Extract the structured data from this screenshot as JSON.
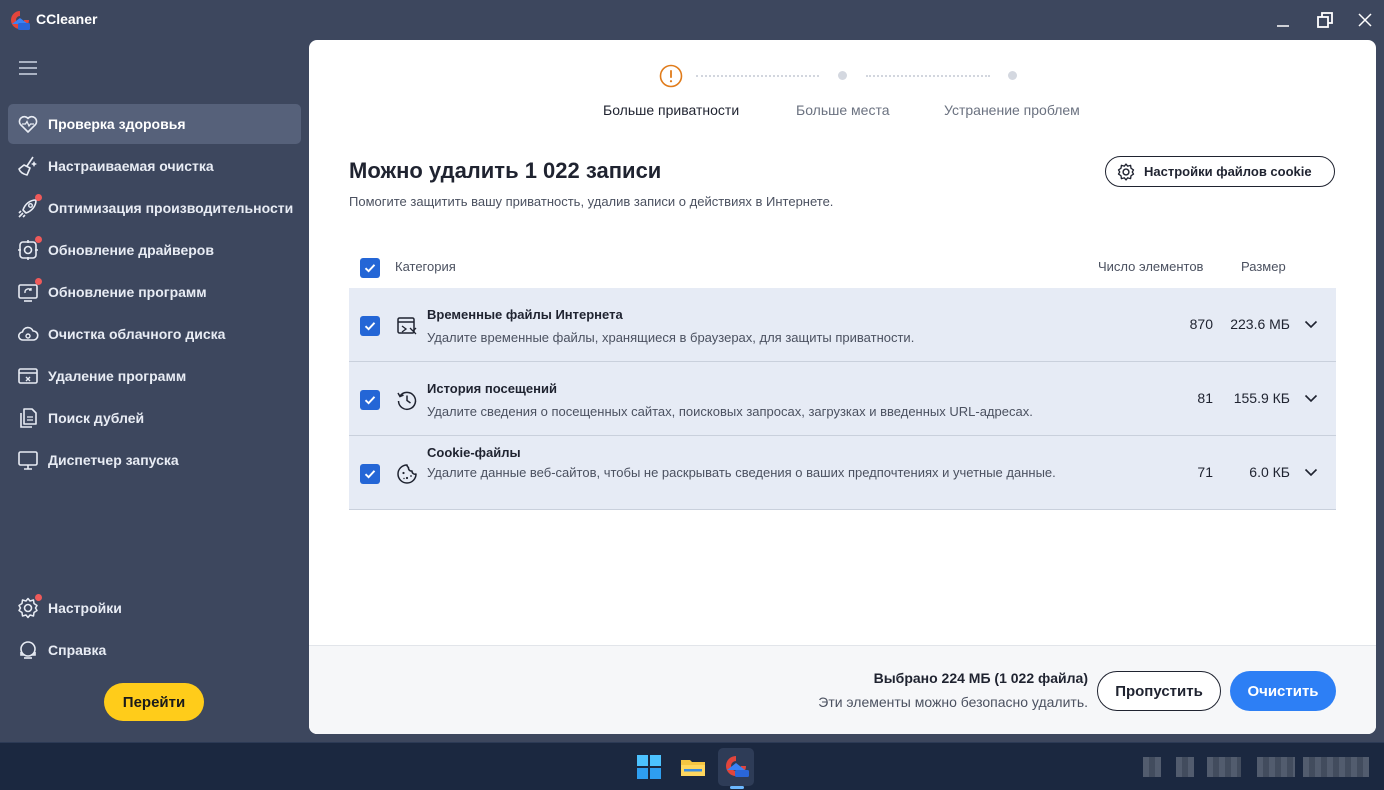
{
  "app": {
    "title": "CCleaner"
  },
  "sidebar": {
    "items": [
      {
        "label": "Проверка здоровья",
        "icon": "heart-icon",
        "active": true,
        "dot": false
      },
      {
        "label": "Настраиваемая очистка",
        "icon": "broom-icon",
        "active": false,
        "dot": false
      },
      {
        "label": "Оптимизация производительности",
        "icon": "rocket-icon",
        "active": false,
        "dot": true
      },
      {
        "label": "Обновление драйверов",
        "icon": "driver-gear-icon",
        "active": false,
        "dot": true
      },
      {
        "label": "Обновление программ",
        "icon": "software-update-icon",
        "active": false,
        "dot": true
      },
      {
        "label": "Очистка облачного диска",
        "icon": "cloud-drive-icon",
        "active": false,
        "dot": false
      },
      {
        "label": "Удаление программ",
        "icon": "uninstall-icon",
        "active": false,
        "dot": false
      },
      {
        "label": "Поиск дублей",
        "icon": "duplicate-files-icon",
        "active": false,
        "dot": false
      },
      {
        "label": "Диспетчер запуска",
        "icon": "monitor-icon",
        "active": false,
        "dot": false
      }
    ],
    "bottom_items": [
      {
        "label": "Настройки",
        "icon": "gear-icon",
        "dot": true
      },
      {
        "label": "Справка",
        "icon": "help-icon",
        "dot": false
      }
    ],
    "go_button": "Перейти"
  },
  "stepper": {
    "steps": [
      "Больше приватности",
      "Больше места",
      "Устранение проблем"
    ],
    "active_index": 0
  },
  "main": {
    "heading": "Можно удалить 1 022 записи",
    "subheading": "Помогите защитить вашу приватность, удалив записи о действиях в Интернете.",
    "cookie_settings_button": "Настройки файлов cookie"
  },
  "table": {
    "headers": {
      "category": "Категория",
      "count": "Число элементов",
      "size": "Размер"
    },
    "rows": [
      {
        "title": "Временные файлы Интернета",
        "description": "Удалите временные файлы, хранящиеся в браузерах, для защиты приватности.",
        "count": "870",
        "size": "223.6 МБ",
        "icon": "browser-temp-files-icon",
        "checked": true
      },
      {
        "title": "История посещений",
        "description": "Удалите сведения о посещенных сайтах, поисковых запросах, загрузках и введенных URL-адресах.",
        "count": "81",
        "size": "155.9 КБ",
        "icon": "history-icon",
        "checked": true
      },
      {
        "title": "Cookie-файлы",
        "description": "Удалите данные веб-сайтов, чтобы не раскрывать сведения о ваших предпочтениях и учетные данные.",
        "count": "71",
        "size": "6.0 КБ",
        "icon": "cookie-icon",
        "checked": true
      }
    ]
  },
  "footer": {
    "selected": "Выбрано 224 МБ (1 022 файла)",
    "note": "Эти элементы можно безопасно удалить.",
    "skip_button": "Пропустить",
    "clean_button": "Очистить"
  },
  "colors": {
    "sidebar_bg": "#3d475e",
    "accent_blue": "#2d7ff5",
    "checkbox_blue": "#2466d6",
    "go_yellow": "#ffcc1a",
    "warning_orange": "#e07b1a",
    "notification_red": "#ef5a5a"
  }
}
